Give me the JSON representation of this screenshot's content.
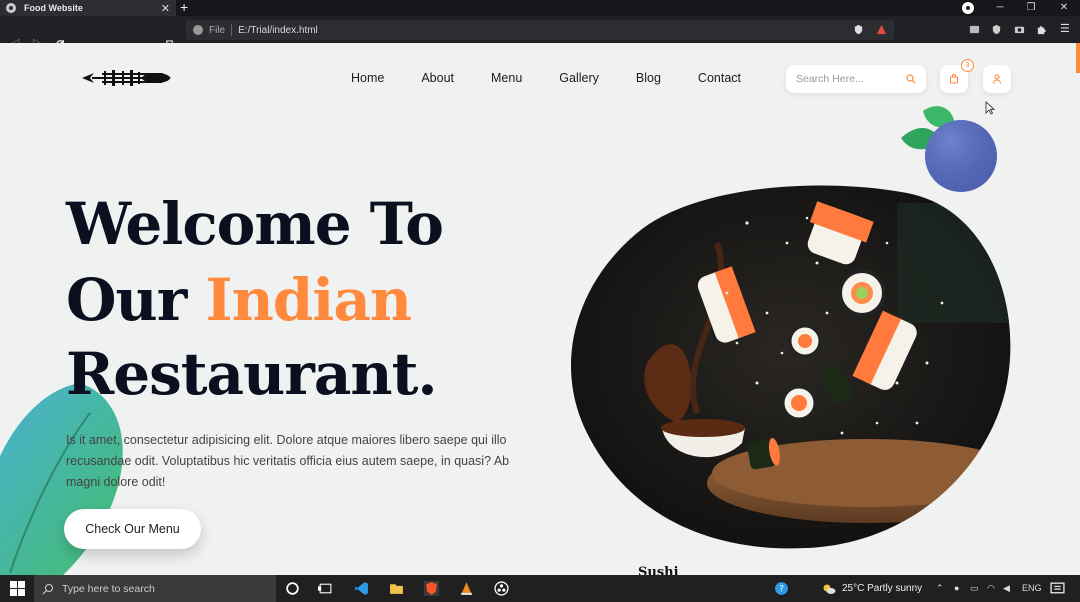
{
  "browser": {
    "tab_title": "Food Website",
    "tab_close": "✕",
    "new_tab": "+",
    "address_scheme": "File",
    "address_path": "E:/Trial/index.html",
    "window_min": "─",
    "window_restore": "❐",
    "window_close": "✕"
  },
  "site": {
    "nav": [
      "Home",
      "About",
      "Menu",
      "Gallery",
      "Blog",
      "Contact"
    ],
    "search_placeholder": "Search Here...",
    "cart_count": "3",
    "hero_line1": "Welcome To",
    "hero_line2_a": "Our ",
    "hero_line2_b": "Indian",
    "hero_line3": "Restaurant.",
    "description": "Is it amet, consectetur adipisicing elit. Dolore atque maiores libero saepe qui illo recusandae odit. Voluptatibus hic veritatis officia eius autem saepe, in quasi? Ab magni dolore odit!",
    "cta": "Check Our Menu",
    "caption": "Sushi",
    "accent_color": "#ff8a3d"
  },
  "taskbar": {
    "search_placeholder": "Type here to search",
    "weather": "25°C  Partly sunny",
    "language": "ENG",
    "icons": [
      "windows-icon",
      "cortana-icon",
      "task-view-icon",
      "vscode-icon",
      "file-explorer-icon",
      "brave-icon",
      "vlc-icon",
      "obs-icon"
    ]
  }
}
